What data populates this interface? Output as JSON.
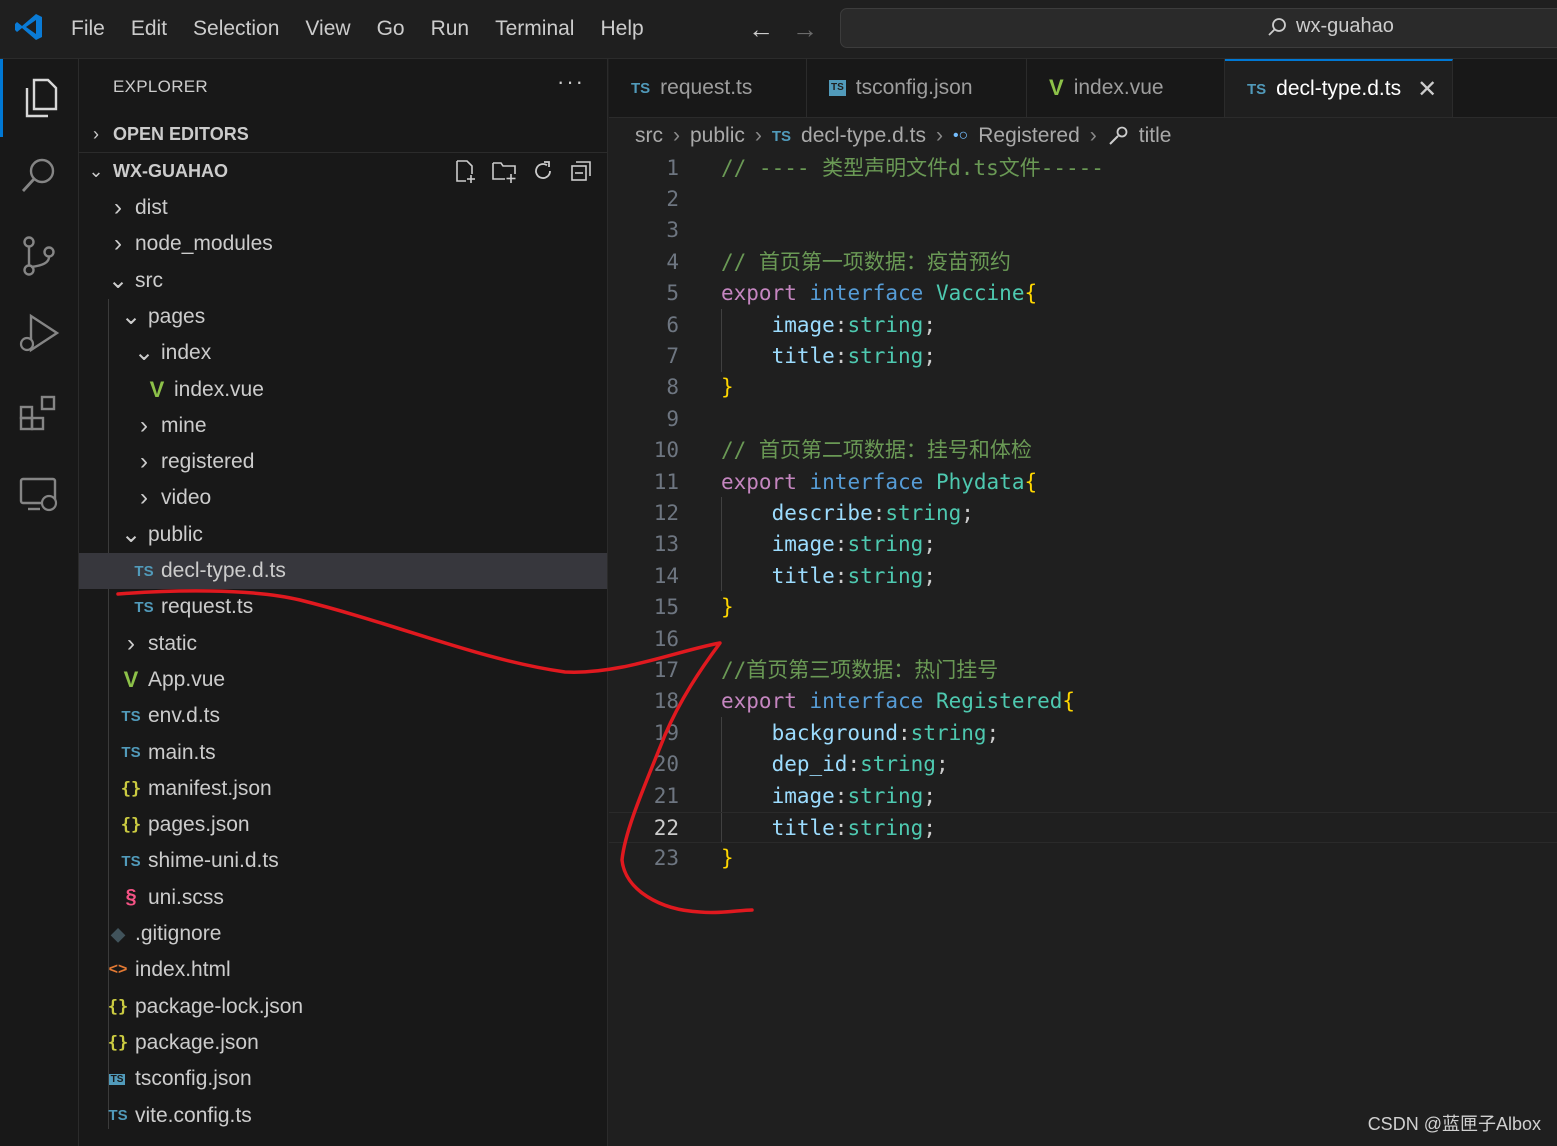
{
  "titlebar": {
    "menu": [
      "File",
      "Edit",
      "Selection",
      "View",
      "Go",
      "Run",
      "Terminal",
      "Help"
    ],
    "search_text": "wx-guahao"
  },
  "explorer": {
    "title": "EXPLORER",
    "more": "···",
    "open_editors": "OPEN EDITORS",
    "project": "WX-GUAHAO",
    "tree": [
      {
        "label": "dist",
        "icon": "chevron-right",
        "depth": 0
      },
      {
        "label": "node_modules",
        "icon": "chevron-right",
        "depth": 0
      },
      {
        "label": "src",
        "icon": "chevron-down",
        "depth": 0
      },
      {
        "label": "pages",
        "icon": "chevron-down",
        "depth": 1
      },
      {
        "label": "index",
        "icon": "chevron-down",
        "depth": 2
      },
      {
        "label": "index.vue",
        "icon": "vue",
        "depth": 3
      },
      {
        "label": "mine",
        "icon": "chevron-right",
        "depth": 2
      },
      {
        "label": "registered",
        "icon": "chevron-right",
        "depth": 2
      },
      {
        "label": "video",
        "icon": "chevron-right",
        "depth": 2
      },
      {
        "label": "public",
        "icon": "chevron-down",
        "depth": 1
      },
      {
        "label": "decl-type.d.ts",
        "icon": "ts",
        "depth": 2,
        "selected": true
      },
      {
        "label": "request.ts",
        "icon": "ts",
        "depth": 2
      },
      {
        "label": "static",
        "icon": "chevron-right",
        "depth": 1
      },
      {
        "label": "App.vue",
        "icon": "vue",
        "depth": 1
      },
      {
        "label": "env.d.ts",
        "icon": "ts",
        "depth": 1
      },
      {
        "label": "main.ts",
        "icon": "ts",
        "depth": 1
      },
      {
        "label": "manifest.json",
        "icon": "json",
        "depth": 1
      },
      {
        "label": "pages.json",
        "icon": "json",
        "depth": 1
      },
      {
        "label": "shime-uni.d.ts",
        "icon": "ts",
        "depth": 1
      },
      {
        "label": "uni.scss",
        "icon": "scss",
        "depth": 1
      },
      {
        "label": ".gitignore",
        "icon": "git",
        "depth": 0
      },
      {
        "label": "index.html",
        "icon": "html",
        "depth": 0
      },
      {
        "label": "package-lock.json",
        "icon": "json",
        "depth": 0
      },
      {
        "label": "package.json",
        "icon": "json",
        "depth": 0
      },
      {
        "label": "tsconfig.json",
        "icon": "tsconfig",
        "depth": 0
      },
      {
        "label": "vite.config.ts",
        "icon": "ts",
        "depth": 0
      }
    ]
  },
  "tabs": [
    {
      "label": "request.ts",
      "icon": "TS"
    },
    {
      "label": "tsconfig.json",
      "icon": "TS"
    },
    {
      "label": "index.vue",
      "icon": "V"
    },
    {
      "label": "decl-type.d.ts",
      "icon": "TS",
      "active": true
    }
  ],
  "breadcrumb": [
    "src",
    "public",
    "decl-type.d.ts",
    "Registered",
    "title"
  ],
  "editor": {
    "current_line": 22,
    "lines": [
      {
        "n": "1",
        "tokens": [
          [
            "cm",
            "// ---- 类型声明文件d.ts文件-----"
          ]
        ]
      },
      {
        "n": "2",
        "tokens": []
      },
      {
        "n": "3",
        "tokens": []
      },
      {
        "n": "4",
        "tokens": [
          [
            "cm",
            "// 首页第一项数据：疫苗预约"
          ]
        ]
      },
      {
        "n": "5",
        "tokens": [
          [
            "kw",
            "export"
          ],
          [
            "pn",
            " "
          ],
          [
            "kw2",
            "interface"
          ],
          [
            "pn",
            " "
          ],
          [
            "ty",
            "Vaccine"
          ],
          [
            "br",
            "{"
          ]
        ]
      },
      {
        "n": "6",
        "tokens": [
          [
            "pn",
            "    "
          ],
          [
            "pr",
            "image"
          ],
          [
            "pn",
            ":"
          ],
          [
            "ty",
            "string"
          ],
          [
            "pn",
            ";"
          ]
        ]
      },
      {
        "n": "7",
        "tokens": [
          [
            "pn",
            "    "
          ],
          [
            "pr",
            "title"
          ],
          [
            "pn",
            ":"
          ],
          [
            "ty",
            "string"
          ],
          [
            "pn",
            ";"
          ]
        ]
      },
      {
        "n": "8",
        "tokens": [
          [
            "br",
            "}"
          ]
        ]
      },
      {
        "n": "9",
        "tokens": []
      },
      {
        "n": "10",
        "tokens": [
          [
            "cm",
            "// 首页第二项数据：挂号和体检"
          ]
        ]
      },
      {
        "n": "11",
        "tokens": [
          [
            "kw",
            "export"
          ],
          [
            "pn",
            " "
          ],
          [
            "kw2",
            "interface"
          ],
          [
            "pn",
            " "
          ],
          [
            "ty",
            "Phydata"
          ],
          [
            "br",
            "{"
          ]
        ]
      },
      {
        "n": "12",
        "tokens": [
          [
            "pn",
            "    "
          ],
          [
            "pr",
            "describe"
          ],
          [
            "pn",
            ":"
          ],
          [
            "ty",
            "string"
          ],
          [
            "pn",
            ";"
          ]
        ]
      },
      {
        "n": "13",
        "tokens": [
          [
            "pn",
            "    "
          ],
          [
            "pr",
            "image"
          ],
          [
            "pn",
            ":"
          ],
          [
            "ty",
            "string"
          ],
          [
            "pn",
            ";"
          ]
        ]
      },
      {
        "n": "14",
        "tokens": [
          [
            "pn",
            "    "
          ],
          [
            "pr",
            "title"
          ],
          [
            "pn",
            ":"
          ],
          [
            "ty",
            "string"
          ],
          [
            "pn",
            ";"
          ]
        ]
      },
      {
        "n": "15",
        "tokens": [
          [
            "br",
            "}"
          ]
        ]
      },
      {
        "n": "16",
        "tokens": []
      },
      {
        "n": "17",
        "tokens": [
          [
            "cm",
            "//首页第三项数据：热门挂号"
          ]
        ]
      },
      {
        "n": "18",
        "tokens": [
          [
            "kw",
            "export"
          ],
          [
            "pn",
            " "
          ],
          [
            "kw2",
            "interface"
          ],
          [
            "pn",
            " "
          ],
          [
            "ty",
            "Registered"
          ],
          [
            "br",
            "{"
          ]
        ]
      },
      {
        "n": "19",
        "tokens": [
          [
            "pn",
            "    "
          ],
          [
            "pr",
            "background"
          ],
          [
            "pn",
            ":"
          ],
          [
            "ty",
            "string"
          ],
          [
            "pn",
            ";"
          ]
        ]
      },
      {
        "n": "20",
        "tokens": [
          [
            "pn",
            "    "
          ],
          [
            "pr",
            "dep_id"
          ],
          [
            "pn",
            ":"
          ],
          [
            "ty",
            "string"
          ],
          [
            "pn",
            ";"
          ]
        ]
      },
      {
        "n": "21",
        "tokens": [
          [
            "pn",
            "    "
          ],
          [
            "pr",
            "image"
          ],
          [
            "pn",
            ":"
          ],
          [
            "ty",
            "string"
          ],
          [
            "pn",
            ";"
          ]
        ]
      },
      {
        "n": "22",
        "tokens": [
          [
            "pn",
            "    "
          ],
          [
            "pr",
            "title"
          ],
          [
            "pn",
            ":"
          ],
          [
            "ty",
            "string"
          ],
          [
            "pn",
            ";"
          ]
        ]
      },
      {
        "n": "23",
        "tokens": [
          [
            "br",
            "}"
          ]
        ]
      }
    ]
  },
  "watermark": "CSDN @蓝匣子Albox",
  "colors": {
    "accent": "#0078d4",
    "annotation": "#e0191f"
  }
}
